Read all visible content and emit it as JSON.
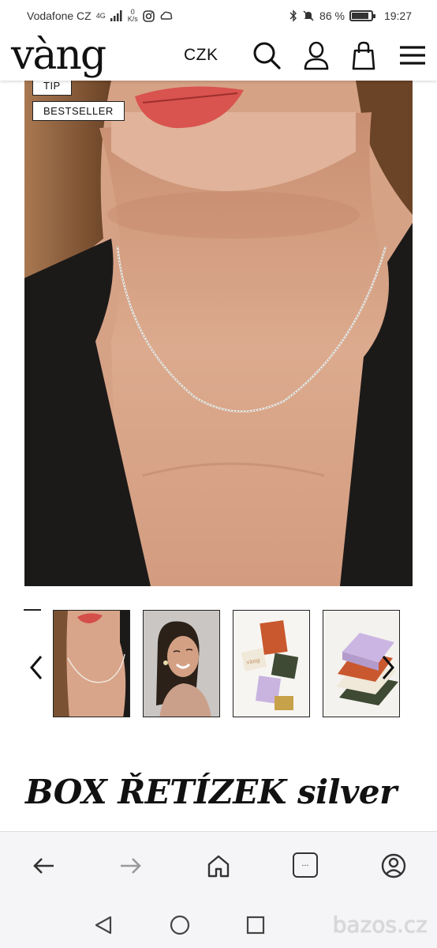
{
  "status_bar": {
    "carrier": "Vodafone CZ",
    "network": "4G",
    "speed_value": "0",
    "speed_unit": "K/s",
    "battery_percent": "86 %",
    "battery_level": 0.86,
    "time": "19:27"
  },
  "header": {
    "logo": "vàng",
    "currency": "CZK",
    "icons": [
      "search-icon",
      "account-icon",
      "cart-icon",
      "menu-icon"
    ]
  },
  "hero": {
    "badges": [
      "TIP",
      "BESTSELLER"
    ]
  },
  "gallery": {
    "thumbnails": [
      "thumbnail-necklace-closeup",
      "thumbnail-model-smiling",
      "thumbnail-gift-boxes",
      "thumbnail-gift-boxes-stack"
    ],
    "box_logo": "vàng"
  },
  "product": {
    "title": "BOX ŘETÍZEK silver"
  },
  "browser": {
    "icons": [
      "back-icon",
      "forward-icon",
      "home-icon",
      "tabs-icon",
      "profile-icon"
    ],
    "tabs_label": "..."
  },
  "nav": {
    "icons": [
      "back-triangle-icon",
      "home-circle-icon",
      "recents-square-icon"
    ],
    "watermark": "bazos.cz"
  },
  "colors": {
    "accent": "#111111",
    "skin": "#d9a58a",
    "jacket": "#1c1a19",
    "hair": "#8a5a36"
  }
}
